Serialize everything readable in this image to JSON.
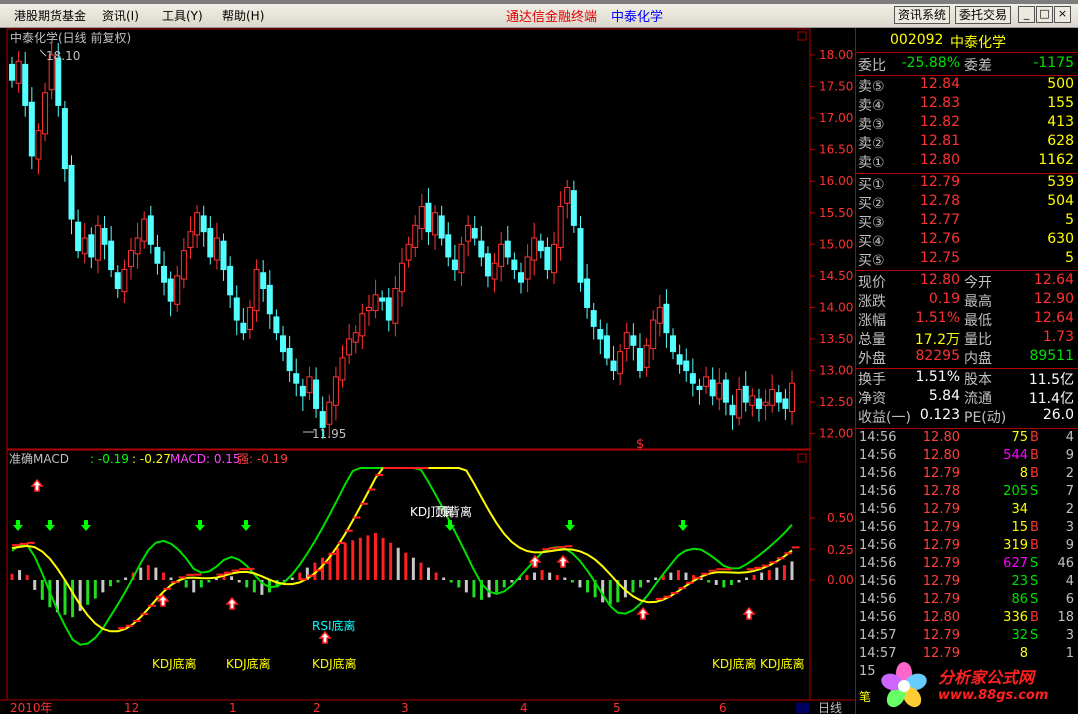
{
  "menu": {
    "items": [
      "港股期货基金",
      "资讯(I)",
      "工具(Y)",
      "帮助(H)"
    ],
    "terminal_title": "通达信金融终端",
    "stock_title": "中泰化学",
    "buttons": [
      "资讯系统",
      "委托交易"
    ],
    "window_controls": [
      "_",
      "□",
      "×"
    ]
  },
  "main_chart": {
    "title": "中泰化学(日线 前复权)",
    "max_label": "18.10",
    "min_label": "11.95",
    "marker": "$",
    "y_ticks": [
      "18.00",
      "17.50",
      "17.00",
      "16.50",
      "16.00",
      "15.50",
      "15.00",
      "14.50",
      "14.00",
      "13.50",
      "13.00",
      "12.50",
      "12.00"
    ]
  },
  "indicator": {
    "name": "准确MACD",
    "v1": ": -0.19",
    "v2": ": -0.27",
    "macd_label": "MACD: 0.15",
    "strong_label": "强: -0.19",
    "y_ticks": [
      "0.50",
      "0.25",
      "0.00"
    ],
    "annotations": [
      "KDJ顶离",
      "顶背离",
      "RSI底离",
      "KDJ底离",
      "KDJ底离",
      "KDJ底离",
      "KDJ底离",
      "KDJ底离"
    ]
  },
  "time_axis": {
    "labels": [
      "2010年",
      "12",
      "1",
      "2",
      "3",
      "4",
      "5",
      "6"
    ],
    "period_button": "日线",
    "extra": "笔"
  },
  "chart_data": {
    "type": "candlestick",
    "ylim": [
      11.9,
      18.3
    ],
    "close": [
      17.6,
      17.9,
      17.2,
      16.4,
      16.8,
      17.4,
      18.0,
      17.2,
      16.2,
      15.4,
      14.9,
      15.1,
      14.8,
      15.3,
      15.0,
      14.6,
      14.3,
      14.6,
      14.9,
      15.1,
      15.4,
      15.0,
      14.7,
      14.4,
      14.1,
      14.5,
      14.9,
      15.2,
      15.5,
      15.2,
      14.8,
      15.1,
      14.6,
      14.2,
      13.8,
      13.6,
      14.0,
      14.6,
      14.3,
      13.9,
      13.6,
      13.3,
      13.0,
      12.8,
      12.6,
      12.9,
      12.4,
      12.1,
      12.5,
      12.9,
      13.2,
      13.5,
      13.6,
      13.9,
      14.0,
      14.2,
      14.1,
      13.8,
      14.3,
      14.7,
      15.0,
      15.3,
      15.6,
      15.2,
      15.5,
      15.1,
      14.8,
      14.6,
      15.0,
      15.3,
      15.1,
      14.8,
      14.5,
      14.7,
      15.0,
      14.8,
      14.6,
      14.4,
      14.8,
      15.1,
      14.9,
      14.6,
      15.0,
      15.6,
      15.9,
      15.3,
      14.4,
      14.0,
      13.7,
      13.5,
      13.2,
      13.0,
      13.3,
      13.6,
      13.4,
      13.0,
      13.4,
      13.8,
      14.0,
      13.6,
      13.3,
      13.1,
      13.0,
      12.8,
      12.7,
      12.9,
      12.6,
      12.8,
      12.5,
      12.3,
      12.7,
      12.5,
      12.6,
      12.4,
      12.5,
      12.7,
      12.5,
      12.4,
      12.8
    ],
    "macd_hist": [
      0.05,
      0.08,
      0.04,
      -0.08,
      -0.16,
      -0.22,
      -0.26,
      -0.28,
      -0.3,
      -0.25,
      -0.2,
      -0.15,
      -0.1,
      -0.05,
      -0.02,
      0.02,
      0.06,
      0.1,
      0.12,
      0.1,
      0.06,
      0.02,
      -0.02,
      -0.06,
      -0.1,
      -0.06,
      -0.02,
      0.02,
      0.05,
      0.03,
      -0.02,
      -0.06,
      -0.1,
      -0.12,
      -0.1,
      -0.06,
      -0.02,
      0.02,
      0.06,
      0.1,
      0.14,
      0.18,
      0.22,
      0.26,
      0.3,
      0.32,
      0.34,
      0.36,
      0.38,
      0.34,
      0.3,
      0.26,
      0.22,
      0.18,
      0.14,
      0.1,
      0.06,
      0.02,
      -0.02,
      -0.06,
      -0.1,
      -0.14,
      -0.16,
      -0.14,
      -0.1,
      -0.06,
      -0.02,
      0.02,
      0.04,
      0.06,
      0.08,
      0.06,
      0.04,
      0.02,
      -0.02,
      -0.06,
      -0.1,
      -0.14,
      -0.18,
      -0.2,
      -0.18,
      -0.14,
      -0.1,
      -0.06,
      -0.02,
      0.02,
      0.04,
      0.06,
      0.08,
      0.06,
      0.04,
      0.02,
      -0.02,
      -0.04,
      -0.06,
      -0.04,
      -0.02,
      0.02,
      0.04,
      0.06,
      0.08,
      0.1,
      0.12,
      0.15
    ]
  },
  "quote": {
    "code": "002092",
    "name": "中泰化学",
    "ratio_label": "委比",
    "ratio_val": "-25.88%",
    "diff_label": "委差",
    "diff_val": "-1175",
    "asks": [
      {
        "label": "卖⑤",
        "price": "12.84",
        "vol": "500"
      },
      {
        "label": "卖④",
        "price": "12.83",
        "vol": "155"
      },
      {
        "label": "卖③",
        "price": "12.82",
        "vol": "413"
      },
      {
        "label": "卖②",
        "price": "12.81",
        "vol": "628"
      },
      {
        "label": "卖①",
        "price": "12.80",
        "vol": "1162"
      }
    ],
    "bids": [
      {
        "label": "买①",
        "price": "12.79",
        "vol": "539"
      },
      {
        "label": "买②",
        "price": "12.78",
        "vol": "504"
      },
      {
        "label": "买③",
        "price": "12.77",
        "vol": "5"
      },
      {
        "label": "买④",
        "price": "12.76",
        "vol": "630"
      },
      {
        "label": "买⑤",
        "price": "12.75",
        "vol": "5"
      }
    ],
    "stats1": [
      {
        "l1": "现价",
        "v1": "12.80",
        "l2": "今开",
        "v2": "12.64"
      },
      {
        "l1": "涨跌",
        "v1": "0.19",
        "l2": "最高",
        "v2": "12.90"
      },
      {
        "l1": "涨幅",
        "v1": "1.51%",
        "l2": "最低",
        "v2": "12.64"
      },
      {
        "l1": "总量",
        "v1": "17.2万",
        "l2": "量比",
        "v2": "1.73"
      },
      {
        "l1": "外盘",
        "v1": "82295",
        "l2": "内盘",
        "v2": "89511"
      }
    ],
    "stats2": [
      {
        "l1": "换手",
        "v1": "1.51%",
        "l2": "股本",
        "v2": "11.5亿"
      },
      {
        "l1": "净资",
        "v1": "5.84",
        "l2": "流通",
        "v2": "11.4亿"
      },
      {
        "l1": "收益(一)",
        "v1": "0.123",
        "l2": "PE(动)",
        "v2": "26.0"
      }
    ]
  },
  "ticks": [
    {
      "time": "14:56",
      "price": "12.80",
      "vol": "75",
      "dir": "B",
      "cnt": "4"
    },
    {
      "time": "14:56",
      "price": "12.80",
      "vol": "544",
      "dir": "B",
      "cnt": "9"
    },
    {
      "time": "14:56",
      "price": "12.79",
      "vol": "8",
      "dir": "B",
      "cnt": "2"
    },
    {
      "time": "14:56",
      "price": "12.78",
      "vol": "205",
      "dir": "S",
      "cnt": "7"
    },
    {
      "time": "14:56",
      "price": "12.79",
      "vol": "34",
      "dir": "",
      "cnt": "2"
    },
    {
      "time": "14:56",
      "price": "12.79",
      "vol": "15",
      "dir": "B",
      "cnt": "3"
    },
    {
      "time": "14:56",
      "price": "12.79",
      "vol": "319",
      "dir": "B",
      "cnt": "9"
    },
    {
      "time": "14:56",
      "price": "12.79",
      "vol": "627",
      "dir": "S",
      "cnt": "46"
    },
    {
      "time": "14:56",
      "price": "12.79",
      "vol": "23",
      "dir": "S",
      "cnt": "4"
    },
    {
      "time": "14:56",
      "price": "12.79",
      "vol": "86",
      "dir": "S",
      "cnt": "6"
    },
    {
      "time": "14:56",
      "price": "12.80",
      "vol": "336",
      "dir": "B",
      "cnt": "18"
    },
    {
      "time": "14:57",
      "price": "12.79",
      "vol": "32",
      "dir": "S",
      "cnt": "3"
    },
    {
      "time": "14:57",
      "price": "12.79",
      "vol": "8",
      "dir": "",
      "cnt": "1"
    },
    {
      "time": "15:",
      "price": "",
      "vol": "",
      "dir": "",
      "cnt": ""
    }
  ],
  "logo": {
    "name": "分析家公式网",
    "url": "www.88gs.com"
  }
}
